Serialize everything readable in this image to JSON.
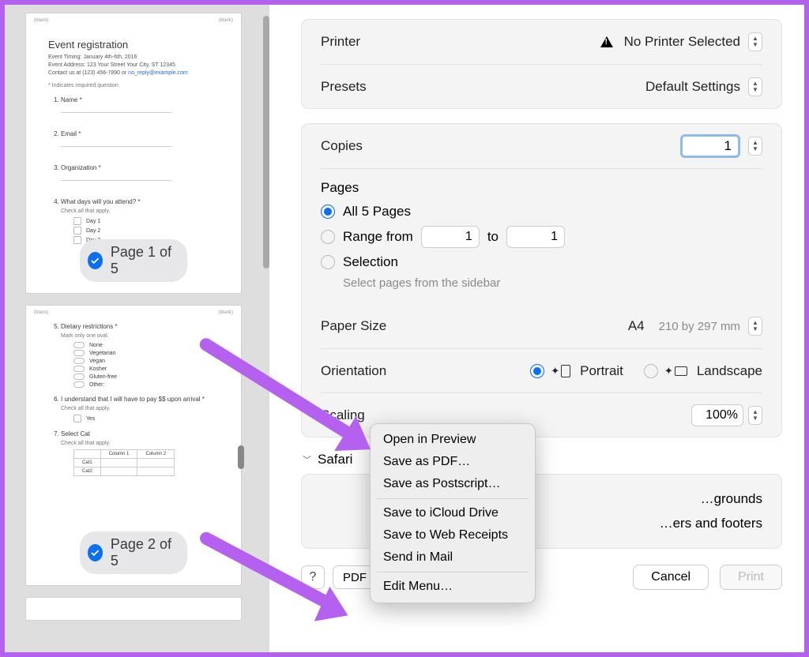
{
  "sidebar": {
    "page1": {
      "badge": "Page 1 of 5",
      "title": "Event registration",
      "timing": "Event Timing: January 4th-6th, 2016",
      "address": "Event Address: 123 Your Street Your City, ST 12345",
      "contact_prefix": "Contact us at (123) 456-7890 or ",
      "contact_link": "no_reply@example.com",
      "required_note": "* Indicates required question",
      "q1": "Name *",
      "q2": "Email *",
      "q3": "Organization *",
      "q4": "What days will you attend? *",
      "q4_sub": "Check all that apply.",
      "q4_opts": [
        "Day 1",
        "Day 2",
        "Day 3"
      ]
    },
    "page2": {
      "badge": "Page 2 of 5",
      "q5": "Dietary restrictions *",
      "q5_sub": "Mark only one oval.",
      "q5_opts": [
        "None",
        "Vegetarian",
        "Vegan",
        "Kosher",
        "Gluten-free",
        "Other:"
      ],
      "q6": "I understand that I will have to pay $$ upon arrival *",
      "q6_sub": "Check all that apply.",
      "q6_opt": "Yes",
      "q7": "Select Cat",
      "q7_sub": "Check all that apply.",
      "q7_cols": [
        "Column 1",
        "Column 2"
      ],
      "q7_rows": [
        "Cat1",
        "Cat2"
      ]
    }
  },
  "panel": {
    "printer_label": "Printer",
    "printer_value": "No Printer Selected",
    "presets_label": "Presets",
    "presets_value": "Default Settings",
    "copies_label": "Copies",
    "copies_value": "1",
    "pages_label": "Pages",
    "pages_all": "All 5 Pages",
    "pages_range": "Range from",
    "pages_range_from": "1",
    "pages_range_to_word": "to",
    "pages_range_to": "1",
    "pages_selection": "Selection",
    "pages_selection_hint": "Select pages from the sidebar",
    "papersize_label": "Paper Size",
    "papersize_value": "A4",
    "papersize_dims": "210 by 297 mm",
    "orientation_label": "Orientation",
    "orientation_portrait": "Portrait",
    "orientation_landscape": "Landscape",
    "scaling_label": "Scaling",
    "scaling_value": "100%",
    "section_safari": "Safari",
    "safari_opt1": "…grounds",
    "safari_opt2": "…ers and footers",
    "help": "?",
    "pdf": "PDF",
    "cancel": "Cancel",
    "print": "Print"
  },
  "menu": {
    "open_preview": "Open in Preview",
    "save_pdf": "Save as PDF…",
    "save_ps": "Save as Postscript…",
    "icloud": "Save to iCloud Drive",
    "web_receipts": "Save to Web Receipts",
    "mail": "Send in Mail",
    "edit": "Edit Menu…"
  }
}
